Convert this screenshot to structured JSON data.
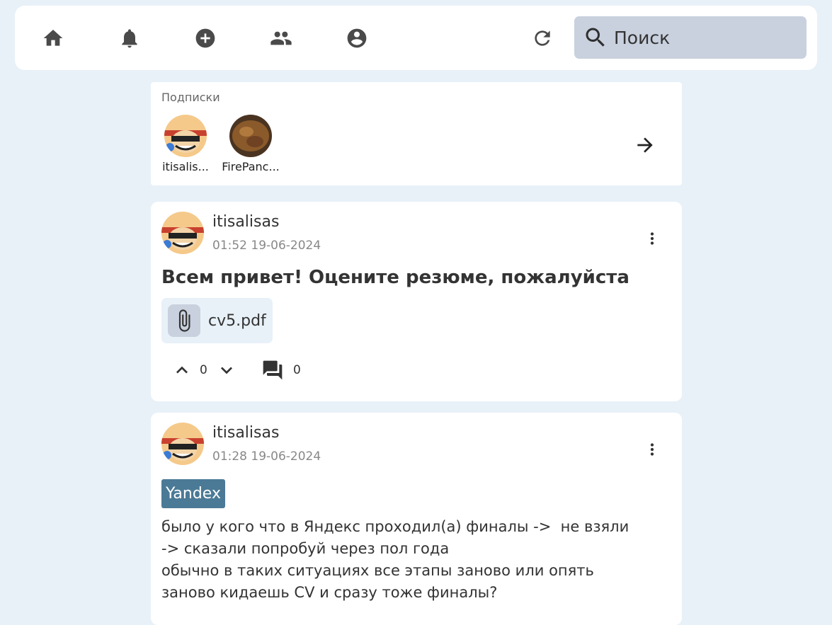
{
  "search": {
    "placeholder": "Поиск"
  },
  "nav": {
    "home": "home-icon",
    "notifications": "bell-icon",
    "create": "add-circle-icon",
    "people": "group-icon",
    "profile": "account-circle-icon",
    "refresh": "refresh-icon"
  },
  "subscriptions": {
    "title": "Подписки",
    "items": [
      {
        "name": "itisalis..."
      },
      {
        "name": "FirePanc..."
      }
    ]
  },
  "posts": [
    {
      "author": "itisalisas",
      "date": "01:52 19-06-2024",
      "title": "Всем привет! Оцените резюме, пожалуйста",
      "attachment": "cv5.pdf",
      "votes": "0",
      "comments": "0"
    },
    {
      "author": "itisalisas",
      "date": "01:28 19-06-2024",
      "tag": "Yandex",
      "text": "было у кого что в Яндекс проходил(а) финалы ->  не взяли\n-> сказали попробуй через пол года\nобычно в таких ситуациях все этапы заново или опять\nзаново кидаешь CV и сразу тоже финалы?"
    }
  ],
  "colors": {
    "background": "#e8f1f8",
    "search_bg": "#c9d1de",
    "tag_bg": "#4b7a96"
  }
}
